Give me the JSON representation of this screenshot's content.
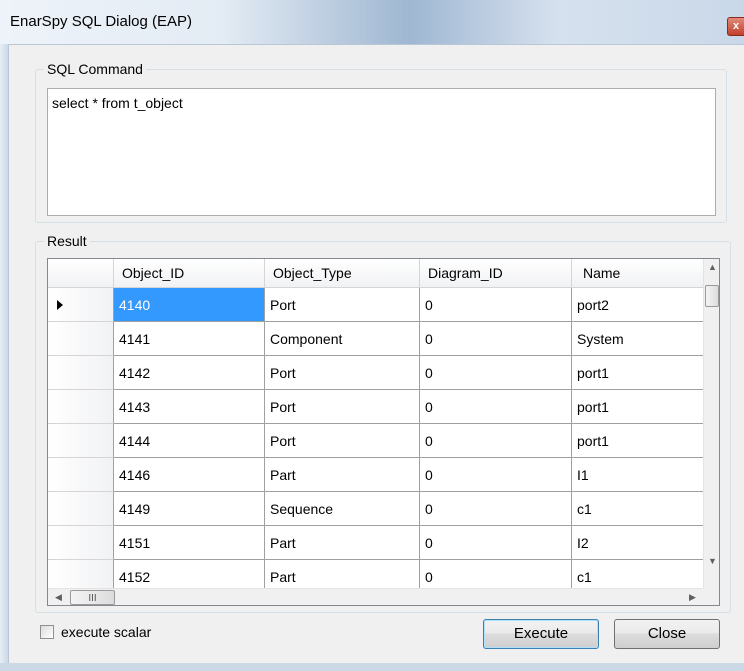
{
  "window": {
    "title": "EnarSpy SQL Dialog (EAP)",
    "close_glyph": "x"
  },
  "sql_group": {
    "label": "SQL Command",
    "command": "select * from t_object"
  },
  "result_group": {
    "label": "Result",
    "columns": [
      "Object_ID",
      "Object_Type",
      "Diagram_ID",
      "Name"
    ],
    "rows": [
      [
        "4140",
        "Port",
        "0",
        "port2"
      ],
      [
        "4141",
        "Component",
        "0",
        "System"
      ],
      [
        "4142",
        "Port",
        "0",
        "port1"
      ],
      [
        "4143",
        "Port",
        "0",
        "port1"
      ],
      [
        "4144",
        "Port",
        "0",
        "port1"
      ],
      [
        "4146",
        "Part",
        "0",
        "I1"
      ],
      [
        "4149",
        "Sequence",
        "0",
        "c1"
      ],
      [
        "4151",
        "Part",
        "0",
        "I2"
      ],
      [
        "4152",
        "Part",
        "0",
        "c1"
      ]
    ],
    "selected_row": 0,
    "current_row_indicator": "current-row-arrow-icon",
    "scrollbar_grip": "III"
  },
  "footer": {
    "execute_scalar_label": "execute scalar",
    "execute_scalar_checked": false,
    "execute_button": "Execute",
    "close_button": "Close"
  },
  "colors": {
    "selection": "#3399ff",
    "window_frame": "#aac4de",
    "dialog_background": "#f0f0f0"
  }
}
